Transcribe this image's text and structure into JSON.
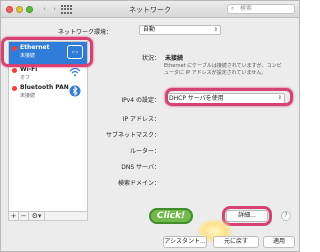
{
  "window": {
    "title": "ネットワーク",
    "search_placeholder": "検索"
  },
  "location": {
    "label": "ネットワーク環境：",
    "value": "自動"
  },
  "services": [
    {
      "name": "Ethernet",
      "status": "未接続",
      "status_color": "#ff3b30",
      "icon": "ethernet-icon",
      "selected": true
    },
    {
      "name": "Wi-Fi",
      "status": "オフ",
      "status_color": "#ff3b30",
      "icon": "wifi-icon",
      "selected": false
    },
    {
      "name": "Bluetooth PAN",
      "status": "未接続",
      "status_color": "#ff3b30",
      "icon": "bluetooth-icon",
      "selected": false
    }
  ],
  "sidebar_footer": {
    "add": "+",
    "remove": "−",
    "action": "⚙▾"
  },
  "details": {
    "status_label": "状況：",
    "status_value": "未接続",
    "status_desc": "Ethernet にケーブルは接続されていますが、コンピュータに IP アドレスが設定されていません。",
    "ipv4_label": "IPv4 の設定：",
    "ipv4_value": "DHCP サーバを使用",
    "ip_label": "IP アドレス：",
    "subnet_label": "サブネットマスク：",
    "router_label": "ルーター：",
    "dns_label": "DNS サーバ：",
    "search_domain_label": "検索ドメイン："
  },
  "buttons": {
    "advanced": "詳細...",
    "help": "?",
    "assist": "アシスタント...",
    "revert": "元に戻す",
    "apply": "適用"
  },
  "annotation": {
    "click_text": "Click!",
    "ring_color": "#d64373",
    "click_color": "#72b94c"
  },
  "accent_color": "#2f7cd9"
}
